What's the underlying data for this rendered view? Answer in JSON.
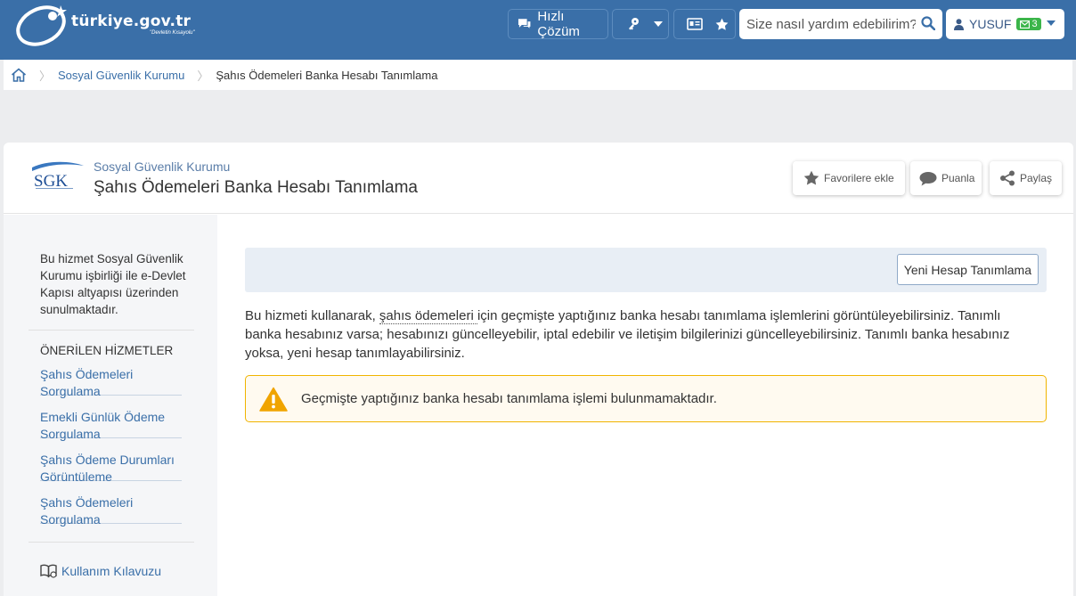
{
  "header": {
    "logo_text": "türkiye.gov.tr",
    "logo_sub": "\"Devletin Kısayolu\"",
    "fast_solution": "Hızlı Çözüm",
    "search_placeholder": "Size nasıl yardım edebilirim?",
    "user_name": "YUSUF",
    "message_count": "3",
    "colors": {
      "bar": "#3a6fa8",
      "badge": "#3bb54a"
    }
  },
  "breadcrumb": {
    "items": [
      "Sosyal Güvenlik Kurumu",
      "Şahıs Ödemeleri Banka Hesabı Tanımlama"
    ]
  },
  "service": {
    "logo_text": "SGK",
    "institution": "Sosyal Güvenlik Kurumu",
    "title": "Şahıs Ödemeleri Banka Hesabı Tanımlama",
    "actions": {
      "favorite": "Favorilere ekle",
      "rate": "Puanla",
      "share": "Paylaş"
    }
  },
  "sidebar": {
    "info": "Bu hizmet Sosyal Güvenlik Kurumu işbirliği ile e-Devlet Kapısı altyapısı üzerinden sunulmaktadır.",
    "recommended_heading": "ÖNERİLEN HİZMETLER",
    "items": [
      {
        "label": "Şahıs Ödemeleri Sorgulama"
      },
      {
        "label": "Emekli Günlük Ödeme Sorgulama"
      },
      {
        "label": "Şahıs Ödeme Durumları Görüntüleme"
      },
      {
        "label": "Şahıs Ödemeleri Sorgulama"
      }
    ],
    "manual": "Kullanım Kılavuzu"
  },
  "main": {
    "new_account_button": "Yeni Hesap Tanımlama",
    "description_before": "Bu hizmeti kullanarak, ",
    "description_term": "şahıs ödemeleri ",
    "description_after": "için geçmişte yaptığınız banka hesabı tanımlama işlemlerini görüntüleyebilirsiniz. Tanımlı banka hesabınız varsa; hesabınızı güncelleyebilir, iptal edebilir ve iletişim bilgilerinizi güncelleyebilirsiniz. Tanımlı banka hesabınız yoksa, yeni hesap tanımlayabilirsiniz.",
    "warning": "Geçmişte yaptığınız banka hesabı tanımlama işlemi bulunmamaktadır.",
    "colors": {
      "warning_border": "#f0b400",
      "warning_icon": "#f0a400"
    }
  },
  "icons": [
    "turkiye-logo-icon",
    "chat-icon",
    "key-icon",
    "chevron-down-icon",
    "id-card-icon",
    "star-icon",
    "search-icon",
    "user-icon",
    "envelope-icon",
    "home-icon",
    "sgk-logo",
    "comment-icon",
    "share-icon",
    "warning-icon",
    "book-icon"
  ]
}
